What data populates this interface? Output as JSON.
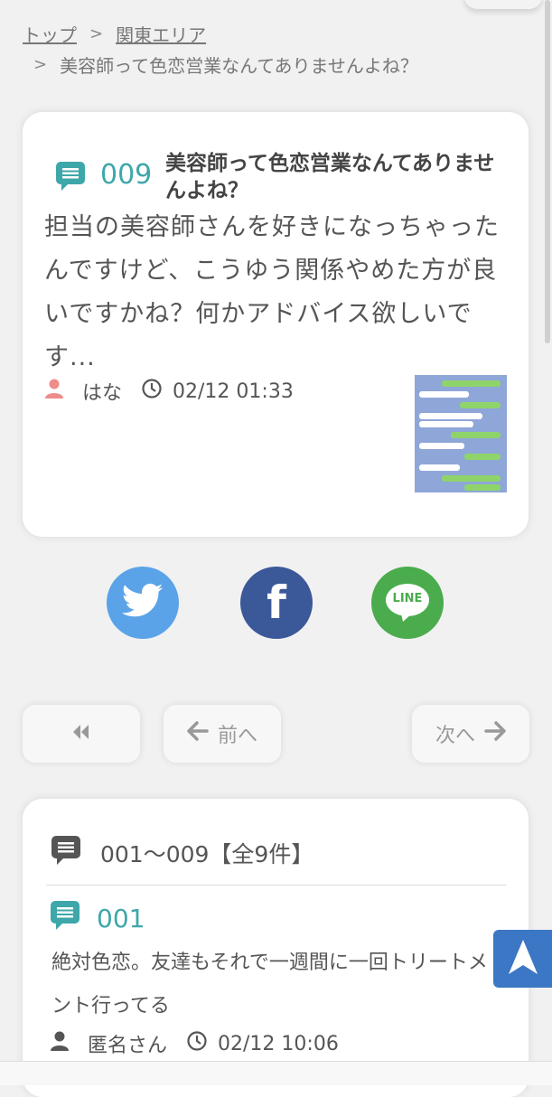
{
  "breadcrumb": {
    "home": "トップ",
    "sep": ">",
    "area": "関東エリア",
    "current": "美容師って色恋営業なんてありませんよね？"
  },
  "post": {
    "number": "009",
    "title": "美容師って色恋営業なんてありませんよね？",
    "body": "担当の美容師さんを好きになっちゃったんですけど、こうゆう関係やめた方が良いですかね？何かアドバイス欲しいです...",
    "author": "はな",
    "datetime": "02/12 01:33",
    "thumbnail": "chat-screenshot-thumbnail"
  },
  "share": {
    "twitter_icon": "twitter-bird-icon",
    "facebook_icon": "facebook-icon",
    "facebook_glyph": "f",
    "line_icon": "line-icon",
    "line_label": "LINE"
  },
  "nav": {
    "prev_label": "前へ",
    "next_label": "次へ"
  },
  "replies": {
    "range_label": "001〜009【全9件】",
    "items": [
      {
        "number": "001",
        "body": "絶対色恋。友達もそれで一週間に一回トリートメント行ってる",
        "author": "匿名さん",
        "datetime": "02/12 10:06"
      }
    ]
  },
  "colors": {
    "accent_teal": "#3ea7aa",
    "twitter": "#5aa3e8",
    "facebook": "#3b5899",
    "line": "#4aac4c",
    "back_to_top": "#3b77c4"
  }
}
